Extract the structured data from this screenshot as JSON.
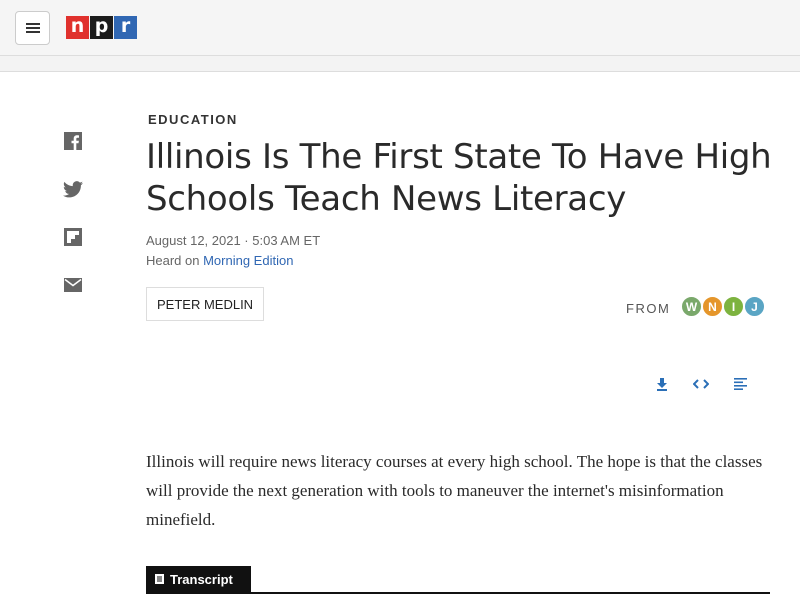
{
  "header": {
    "menu_icon": "hamburger-menu-icon",
    "logo": {
      "letters": [
        "n",
        "p",
        "r"
      ],
      "colors": [
        "#e0312d",
        "#1c1c1c",
        "#3067b3"
      ]
    }
  },
  "share": {
    "icons": [
      "facebook-icon",
      "twitter-icon",
      "flipboard-icon",
      "email-icon"
    ]
  },
  "article": {
    "slug": "EDUCATION",
    "headline": "Illinois Is The First State To Have High Schools Teach News Literacy",
    "date": "August 12, 2021 · 5:03 AM ET",
    "heard_prefix": "Heard on ",
    "heard_program": "Morning Edition",
    "byline": "PETER MEDLIN",
    "from_label": "FROM",
    "station": {
      "letters": [
        "W",
        "N",
        "I",
        "J"
      ],
      "colors": [
        "#7aa86b",
        "#e5962b",
        "#7db33f",
        "#5aa5c4"
      ]
    },
    "tools": [
      "download-icon",
      "embed-icon",
      "transcript-icon"
    ],
    "teaser": "Illinois will require news literacy courses at every high school. The hope is that the classes will provide the next generation with tools to maneuver the internet's misinformation minefield.",
    "transcript_label": "Transcript"
  },
  "colors": {
    "link": "#3067b3",
    "tool_icon": "#2b6fb7"
  }
}
